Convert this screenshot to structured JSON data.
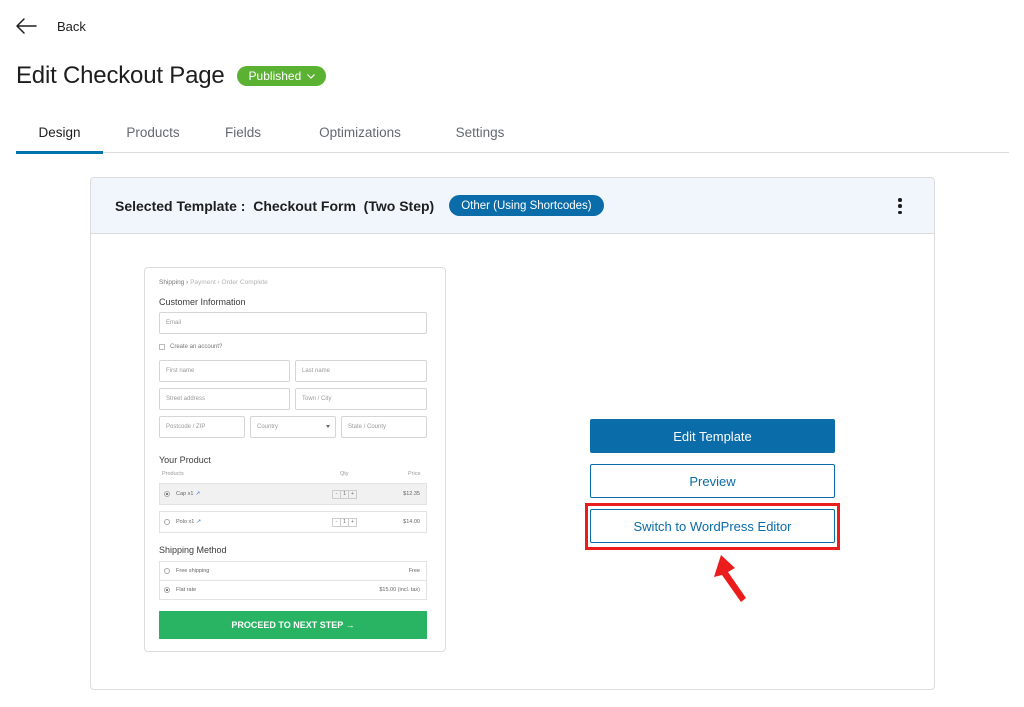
{
  "header": {
    "back_label": "Back",
    "title": "Edit Checkout Page",
    "status": "Published"
  },
  "tabs": [
    {
      "label": "Design",
      "active": true
    },
    {
      "label": "Products",
      "active": false
    },
    {
      "label": "Fields",
      "active": false
    },
    {
      "label": "Optimizations",
      "active": false
    },
    {
      "label": "Settings",
      "active": false
    }
  ],
  "card": {
    "template_label": "Selected Template :  Checkout Form  (Two Step)",
    "badge": "Other (Using Shortcodes)",
    "buttons": {
      "edit": "Edit Template",
      "preview": "Preview",
      "switch": "Switch to WordPress Editor"
    },
    "highlight_color": "#ea1c1c"
  },
  "preview": {
    "breadcrumb": {
      "current": "Shipping",
      "rest": "Payment  ›  Order Complete"
    },
    "customer_heading": "Customer Information",
    "email": "Email",
    "create_account": "Create an account?",
    "first_name": "First name",
    "last_name": "Last name",
    "street": "Street address",
    "town": "Town / City",
    "postcode": "Postcode / ZIP",
    "country": "Country",
    "state": "State / County",
    "product_heading": "Your Product",
    "col_products": "Products",
    "col_qty": "Qty",
    "col_price": "Price",
    "items": [
      {
        "name": "Cap x1",
        "qty": "1",
        "price": "$12.35"
      },
      {
        "name": "Polo x1",
        "qty": "1",
        "price": "$14.00"
      }
    ],
    "shipping_heading": "Shipping Method",
    "shipping": [
      {
        "name": "Free shipping",
        "price": "Free"
      },
      {
        "name": "Flat rate",
        "price": "$15.00 (incl. tax)"
      }
    ],
    "proceed": "PROCEED TO NEXT STEP →"
  },
  "colors": {
    "accent": "#0a6ca8",
    "published": "#5bb132",
    "proceed": "#28b463"
  }
}
